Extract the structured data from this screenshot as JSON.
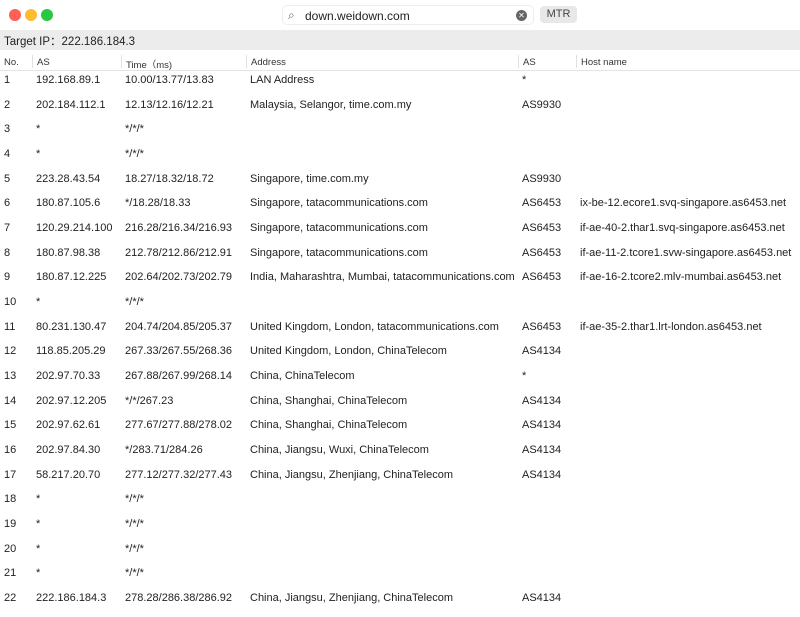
{
  "window": {
    "search_value": "down.weidown.com",
    "button_label": "MTR",
    "search_icon": "magnifier-icon",
    "clear_icon": "clear-icon"
  },
  "target": {
    "label": "Target IP：",
    "ip": "222.186.184.3"
  },
  "columns": [
    "No.",
    "AS",
    "Time（ms)",
    "Address",
    "AS",
    "Host name"
  ],
  "rows": [
    [
      "1",
      "192.168.89.1",
      "10.00/13.77/13.83",
      "LAN Address",
      "*",
      ""
    ],
    [
      "2",
      "202.184.112.1",
      "12.13/12.16/12.21",
      "Malaysia, Selangor, time.com.my",
      "AS9930",
      ""
    ],
    [
      "3",
      "*",
      "*/*/*",
      "",
      "",
      ""
    ],
    [
      "4",
      "*",
      "*/*/*",
      "",
      "",
      ""
    ],
    [
      "5",
      "223.28.43.54",
      "18.27/18.32/18.72",
      "Singapore, time.com.my",
      "AS9930",
      ""
    ],
    [
      "6",
      "180.87.105.6",
      "*/18.28/18.33",
      "Singapore, tatacommunications.com",
      "AS6453",
      "ix-be-12.ecore1.svq-singapore.as6453.net"
    ],
    [
      "7",
      "120.29.214.100",
      "216.28/216.34/216.93",
      "Singapore, tatacommunications.com",
      "AS6453",
      "if-ae-40-2.thar1.svq-singapore.as6453.net"
    ],
    [
      "8",
      "180.87.98.38",
      "212.78/212.86/212.91",
      "Singapore, tatacommunications.com",
      "AS6453",
      "if-ae-11-2.tcore1.svw-singapore.as6453.net"
    ],
    [
      "9",
      "180.87.12.225",
      "202.64/202.73/202.79",
      "India, Maharashtra, Mumbai, tatacommunications.com",
      "AS6453",
      "if-ae-16-2.tcore2.mlv-mumbai.as6453.net"
    ],
    [
      "10",
      "*",
      "*/*/*",
      "",
      "",
      ""
    ],
    [
      "11",
      "80.231.130.47",
      "204.74/204.85/205.37",
      "United Kingdom, London, tatacommunications.com",
      "AS6453",
      "if-ae-35-2.thar1.lrt-london.as6453.net"
    ],
    [
      "12",
      "118.85.205.29",
      "267.33/267.55/268.36",
      "United Kingdom, London, ChinaTelecom",
      "AS4134",
      ""
    ],
    [
      "13",
      "202.97.70.33",
      "267.88/267.99/268.14",
      "China, ChinaTelecom",
      "*",
      ""
    ],
    [
      "14",
      "202.97.12.205",
      "*/*/267.23",
      "China, Shanghai, ChinaTelecom",
      "AS4134",
      ""
    ],
    [
      "15",
      "202.97.62.61",
      "277.67/277.88/278.02",
      "China, Shanghai, ChinaTelecom",
      "AS4134",
      ""
    ],
    [
      "16",
      "202.97.84.30",
      "*/283.71/284.26",
      "China, Jiangsu, Wuxi, ChinaTelecom",
      "AS4134",
      ""
    ],
    [
      "17",
      "58.217.20.70",
      "277.12/277.32/277.43",
      "China, Jiangsu, Zhenjiang, ChinaTelecom",
      "AS4134",
      ""
    ],
    [
      "18",
      "*",
      "*/*/*",
      "",
      "",
      ""
    ],
    [
      "19",
      "*",
      "*/*/*",
      "",
      "",
      ""
    ],
    [
      "20",
      "*",
      "*/*/*",
      "",
      "",
      ""
    ],
    [
      "21",
      "*",
      "*/*/*",
      "",
      "",
      ""
    ],
    [
      "22",
      "222.186.184.3",
      "278.28/286.38/286.92",
      "China, Jiangsu, Zhenjiang, ChinaTelecom",
      "AS4134",
      ""
    ]
  ]
}
